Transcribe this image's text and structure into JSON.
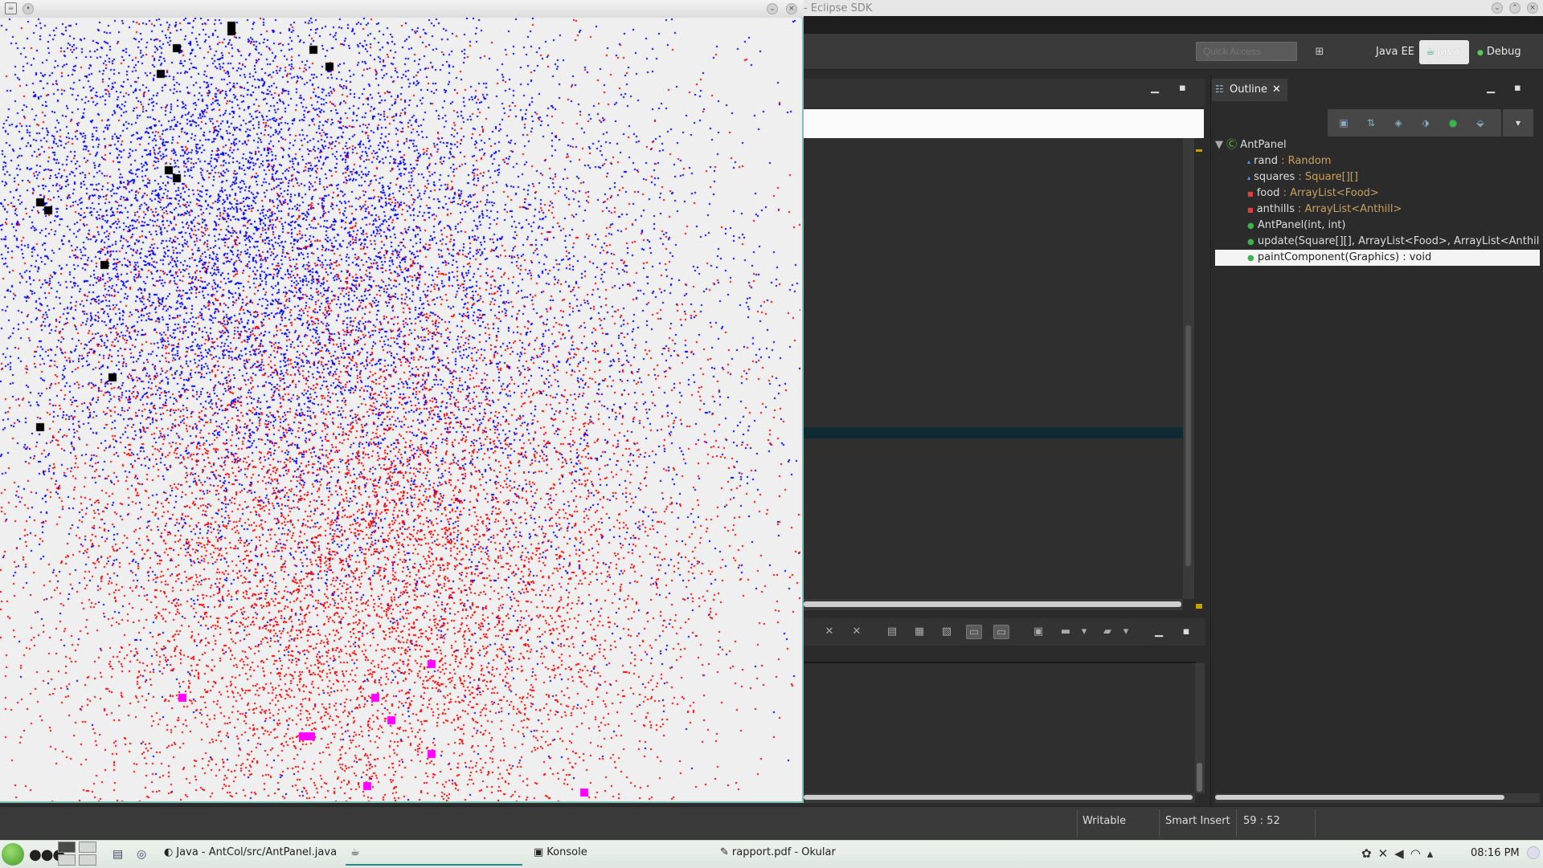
{
  "eclipse": {
    "title_suffix": "- Eclipse SDK",
    "quick_access_placeholder": "Quick Access",
    "perspectives": [
      "Java EE",
      "Java",
      "Debug"
    ],
    "outline": {
      "tab_label": "Outline",
      "class_name": "AntPanel",
      "members": [
        {
          "name": "rand",
          "type": " : Random",
          "visibility": "public-field"
        },
        {
          "name": "squares",
          "type": " : Square[][]",
          "visibility": "public-field"
        },
        {
          "name": "food",
          "type": " : ArrayList<Food>",
          "visibility": "private-field"
        },
        {
          "name": "anthills",
          "type": " : ArrayList<Anthill>",
          "visibility": "private-field"
        },
        {
          "name": "AntPanel(int, int)",
          "type": "",
          "visibility": "constructor"
        },
        {
          "name": "update(Square[][], ArrayList<Food>, ArrayList<Anthill>",
          "type": "",
          "visibility": "public-method"
        },
        {
          "name": "paintComponent(Graphics) : void",
          "type": "",
          "visibility": "public-method",
          "selected": true
        }
      ]
    },
    "status": {
      "writable": "Writable",
      "insert_mode": "Smart Insert",
      "position": "59 : 52"
    }
  },
  "ant_window": {
    "colors": {
      "colony_a": "#0000ff",
      "colony_b": "#ff0000",
      "anthill_a": "#000000",
      "anthill_b": "#ff00ff",
      "background": "#efefef"
    }
  },
  "taskbar": {
    "tasks": [
      {
        "label": "Java - AntCol/src/AntPanel.java",
        "icon": "eclipse-icon"
      },
      {
        "label": "",
        "icon": "java-app-icon"
      },
      {
        "label": "Konsole",
        "icon": "terminal-icon"
      },
      {
        "label": "rapport.pdf - Okular",
        "icon": "okular-icon"
      }
    ],
    "clock": "08:16 PM"
  }
}
